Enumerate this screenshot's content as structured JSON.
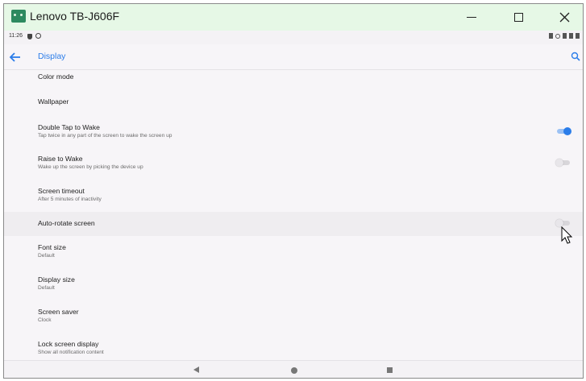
{
  "window": {
    "title": "Lenovo TB-J606F"
  },
  "status_bar": {
    "time": "11:26"
  },
  "app_bar": {
    "title": "Display"
  },
  "settings": [
    {
      "title": "Color mode",
      "subtitle": ""
    },
    {
      "title": "Wallpaper",
      "subtitle": ""
    },
    {
      "title": "Double Tap to Wake",
      "subtitle": "Tap twice in any part of the screen to wake the screen up",
      "toggle": "on"
    },
    {
      "title": "Raise to Wake",
      "subtitle": "Wake up the screen by picking the device up",
      "toggle": "off"
    },
    {
      "title": "Screen timeout",
      "subtitle": "After 5 minutes of inactivity"
    },
    {
      "title": "Auto-rotate screen",
      "subtitle": "",
      "toggle": "off"
    },
    {
      "title": "Font size",
      "subtitle": "Default"
    },
    {
      "title": "Display size",
      "subtitle": "Default"
    },
    {
      "title": "Screen saver",
      "subtitle": "Clock"
    },
    {
      "title": "Lock screen display",
      "subtitle": "Show all notification content"
    }
  ],
  "colors": {
    "accent": "#2b7de9",
    "titlebar": "#e6f8e6",
    "background": "#f7f5f8"
  }
}
